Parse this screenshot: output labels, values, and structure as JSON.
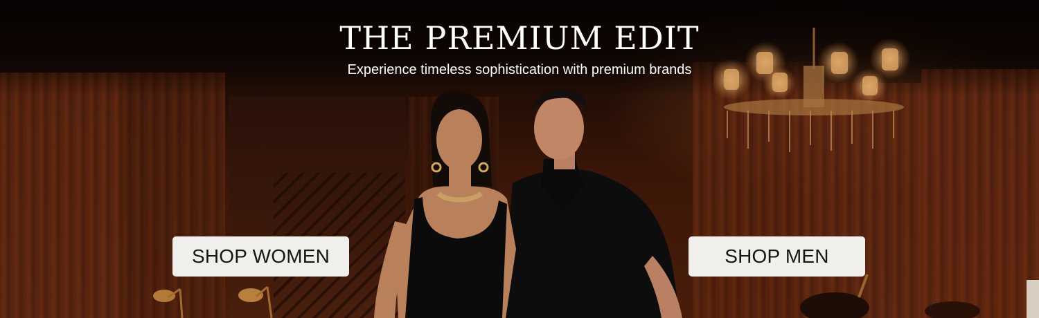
{
  "hero": {
    "title": "THE PREMIUM EDIT",
    "subtitle": "Experience timeless sophistication with premium brands",
    "cta_women_label": "SHOP WOMEN",
    "cta_men_label": "SHOP MEN"
  },
  "colors": {
    "button_bg": "#f1efeb",
    "button_text": "#151515",
    "title_text": "#ffffff",
    "background_wood": "#5a2410"
  }
}
